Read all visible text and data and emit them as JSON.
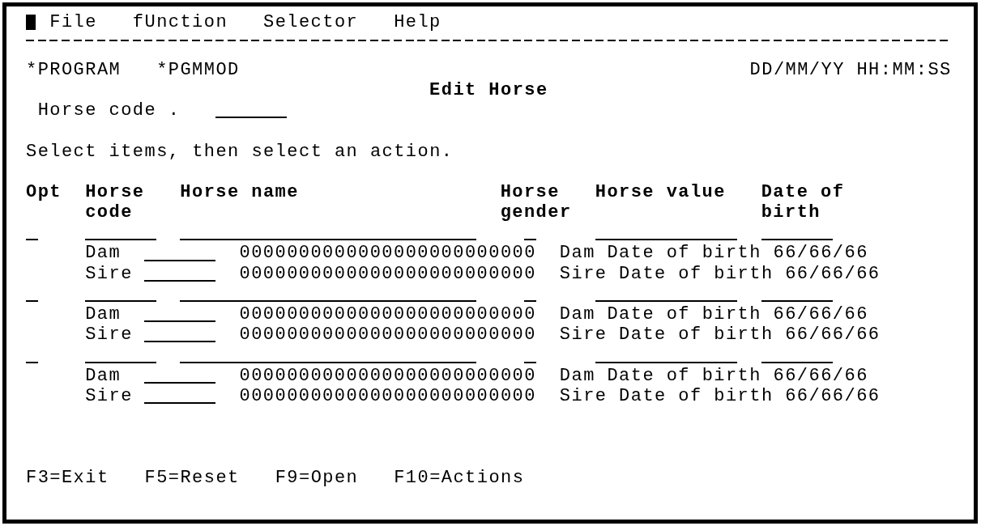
{
  "menu_bar": [
    "File",
    "fUnction",
    "Selector",
    "Help"
  ],
  "header": {
    "program": "*PROGRAM",
    "module": "*PGMMOD",
    "date_time": "DD/MM/YY HH:MM:SS",
    "title": "Edit Horse"
  },
  "position_to": {
    "label": "Horse code ."
  },
  "instruction": "Select items, then select an action.",
  "table": {
    "columns": [
      "Opt",
      "Horse code",
      "Horse name",
      "Horse gender",
      "Horse value",
      "Date of birth"
    ],
    "rows": [
      {
        "parents": [
          {
            "label": "Dam",
            "name": "0000000000000000000000000",
            "birth": "Dam Date of birth 66/66/66"
          },
          {
            "label": "Sire",
            "name": "0000000000000000000000000",
            "birth": "Sire Date of birth 66/66/66"
          }
        ]
      },
      {
        "parents": [
          {
            "label": "Dam",
            "name": "0000000000000000000000000",
            "birth": "Dam Date of birth 66/66/66"
          },
          {
            "label": "Sire",
            "name": "0000000000000000000000000",
            "birth": "Sire Date of birth 66/66/66"
          }
        ]
      },
      {
        "parents": [
          {
            "label": "Dam",
            "name": "0000000000000000000000000",
            "birth": "Dam Date of birth 66/66/66"
          },
          {
            "label": "Sire",
            "name": "0000000000000000000000000",
            "birth": "Sire Date of birth 66/66/66"
          }
        ]
      }
    ]
  },
  "function_keys": [
    "F3=Exit",
    "F5=Reset",
    "F9=Open",
    "F10=Actions"
  ]
}
